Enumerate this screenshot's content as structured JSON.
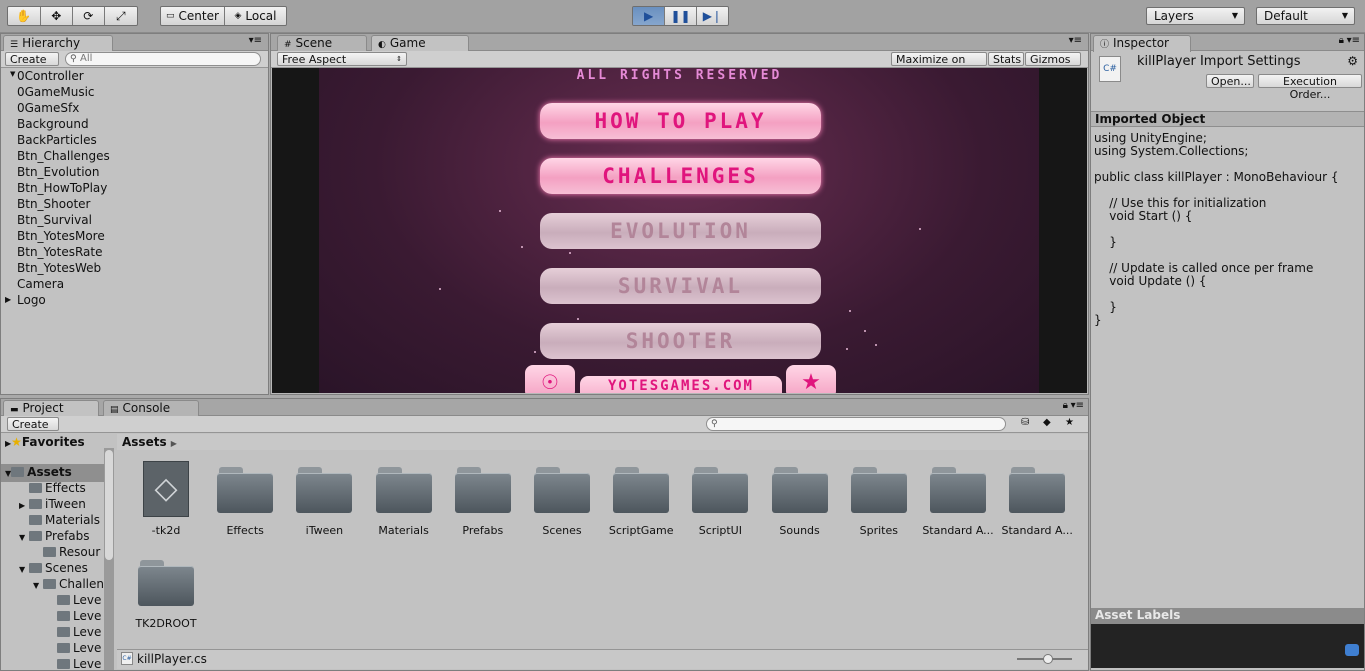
{
  "toolbar": {
    "pivot_center": "Center",
    "pivot_local": "Local",
    "layers_label": "Layers",
    "layout_label": "Default"
  },
  "hierarchy": {
    "tab": "Hierarchy",
    "create": "Create",
    "search_placeholder": "All",
    "items": [
      "0Controller",
      "0GameMusic",
      "0GameSfx",
      "Background",
      "BackParticles",
      "Btn_Challenges",
      "Btn_Evolution",
      "Btn_HowToPlay",
      "Btn_Shooter",
      "Btn_Survival",
      "Btn_YotesMore",
      "Btn_YotesRate",
      "Btn_YotesWeb",
      "Camera",
      "Logo"
    ]
  },
  "scene_tab": "Scene",
  "game": {
    "tab": "Game",
    "aspect": "Free Aspect",
    "maximize": "Maximize on Play",
    "stats": "Stats",
    "gizmos": "Gizmos",
    "rights": "ALL RIGHTS RESERVED",
    "buttons": [
      "HOW TO PLAY",
      "CHALLENGES",
      "EVOLUTION",
      "SURVIVAL",
      "SHOOTER"
    ],
    "website": "YOTESGAMES.COM"
  },
  "inspector": {
    "tab": "Inspector",
    "title": "killPlayer Import Settings",
    "open_btn": "Open...",
    "exec_btn": "Execution Order...",
    "imported_header": "Imported Object",
    "code": [
      "using UnityEngine;",
      "using System.Collections;",
      "",
      "public class killPlayer : MonoBehaviour {",
      "",
      "    // Use this for initialization",
      "    void Start () {",
      "",
      "    }",
      "",
      "    // Update is called once per frame",
      "    void Update () {",
      "",
      "    }",
      "}"
    ],
    "asset_labels": "Asset Labels"
  },
  "project": {
    "tab": "Project",
    "console_tab": "Console",
    "create": "Create",
    "favorites": "Favorites",
    "assets_root": "Assets",
    "breadcrumb": "Assets",
    "tree": [
      {
        "label": "Effects",
        "indent": 1
      },
      {
        "label": "iTween",
        "indent": 1
      },
      {
        "label": "Materials",
        "indent": 1
      },
      {
        "label": "Prefabs",
        "indent": 1
      },
      {
        "label": "Resour",
        "indent": 2
      },
      {
        "label": "Scenes",
        "indent": 1
      },
      {
        "label": "Challen",
        "indent": 2
      },
      {
        "label": "Leve",
        "indent": 3
      },
      {
        "label": "Leve",
        "indent": 3
      },
      {
        "label": "Leve",
        "indent": 3
      },
      {
        "label": "Leve",
        "indent": 3
      },
      {
        "label": "Leve",
        "indent": 3
      }
    ],
    "assets": [
      "-tk2d",
      "Effects",
      "iTween",
      "Materials",
      "Prefabs",
      "Scenes",
      "ScriptGame",
      "ScriptUI",
      "Sounds",
      "Sprites",
      "Standard A...",
      "Standard A...",
      "TK2DROOT"
    ],
    "selected_file": "killPlayer.cs"
  }
}
